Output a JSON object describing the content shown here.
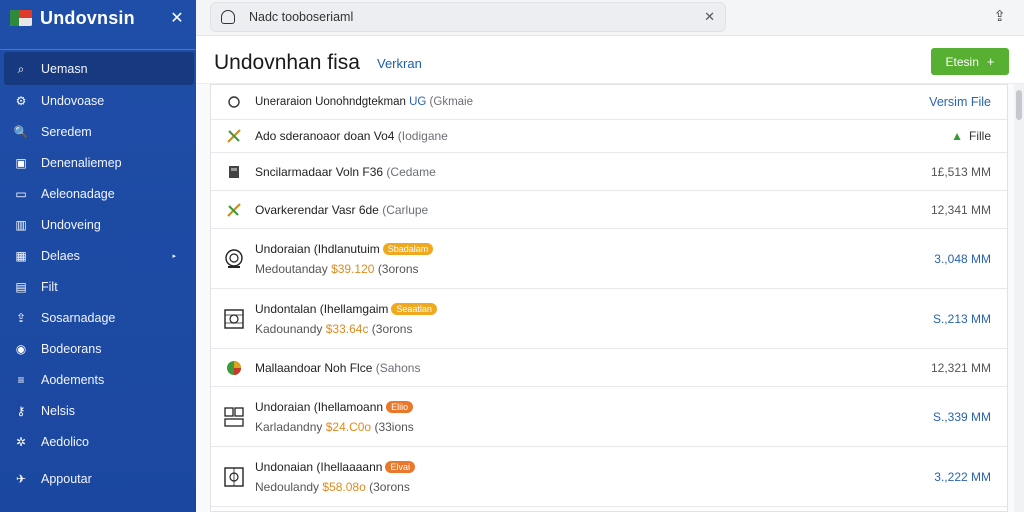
{
  "sidebar": {
    "title": "Undovnsin",
    "close": "✕",
    "items": [
      {
        "label": "Uemasn",
        "icon": "search-icon",
        "glyph": "⌕"
      },
      {
        "label": "Undovoase",
        "icon": "settings-icon",
        "glyph": "⚙"
      },
      {
        "label": "Seredem",
        "icon": "search-icon",
        "glyph": "🔍"
      },
      {
        "label": "Denenaliemep",
        "icon": "briefcase-icon",
        "glyph": "▣"
      },
      {
        "label": "Aeleonadage",
        "icon": "car-icon",
        "glyph": "▭"
      },
      {
        "label": "Undoveing",
        "icon": "chart-icon",
        "glyph": "▥"
      },
      {
        "label": "Delaes",
        "icon": "grid-icon",
        "glyph": "▦",
        "arrow": "▸"
      },
      {
        "label": "Filt",
        "icon": "file-icon",
        "glyph": "▤"
      },
      {
        "label": "Sosarnadage",
        "icon": "share-icon",
        "glyph": "⇪"
      },
      {
        "label": "Bodeorans",
        "icon": "chat-icon",
        "glyph": "◉"
      },
      {
        "label": "Aodements",
        "icon": "list-icon",
        "glyph": "≡"
      },
      {
        "label": "Nelsis",
        "icon": "key-icon",
        "glyph": "⚷"
      },
      {
        "label": "Aedolico",
        "icon": "gear-icon",
        "glyph": "✲"
      },
      {
        "label": "Appoutar",
        "icon": "plane-icon",
        "glyph": "✈"
      }
    ]
  },
  "tab": {
    "label": "Nadc tooboseriaml",
    "close": "✕"
  },
  "top_action_glyph": "⇪",
  "page": {
    "title": "Undovnhan fisa",
    "subtitle": "Verkran",
    "button_label": "Etesin",
    "button_plus": "+"
  },
  "rows": [
    {
      "kind": "head",
      "main": "Uneraraion Uonohndgtekman",
      "tag": "UG",
      "muted": "Gkmaie",
      "right": "Versim File"
    },
    {
      "kind": "thin",
      "main": "Ado sderanoaor doan Vo4",
      "muted": "Iodigane",
      "right": "Fille"
    },
    {
      "kind": "mid",
      "main": "Sncilarmadaar Voln F36",
      "muted": "Cedame",
      "right": "1£,513 MM"
    },
    {
      "kind": "mid",
      "main": "Ovarkerendar Vasr 6de",
      "muted": "Carlupe",
      "right": "12,341 MM"
    },
    {
      "kind": "tall",
      "line1": "Undoraian (Ihdlanutuim",
      "badge": "Sbadalam",
      "badge_color": "amber",
      "line2_a": "Medoutanday",
      "price": "$39.120",
      "line2_b": "(3orons",
      "right": "3.,048 MM"
    },
    {
      "kind": "tall",
      "line1": "Undontalan (Ihellamgaim",
      "badge": "Seaatlan",
      "badge_color": "amber",
      "line2_a": "Kadounandy",
      "price": "$33.64c",
      "line2_b": "(3orons",
      "right": "S.,213 MM"
    },
    {
      "kind": "mid",
      "main": "Mallaandoar Noh Flce",
      "muted": "Sahons",
      "right": "12,321 MM"
    },
    {
      "kind": "tall",
      "line1": "Undoraian (Ihellamoann",
      "badge": "Eliio",
      "badge_color": "orange",
      "line2_a": "Karladandny",
      "price": "$24.C0o",
      "line2_b": "(33ions",
      "right": "S.,339 MM"
    },
    {
      "kind": "tall",
      "line1": "Undonaian (Ihellaaaann",
      "badge": "Elvai",
      "badge_color": "orange",
      "line2_a": "Nedoulandy",
      "price": "$58.08o",
      "line2_b": "(3orons",
      "right": "3.,222 MM"
    }
  ],
  "colors": {
    "sidebar": "#1e4ea8",
    "accent_green": "#58b032",
    "link_blue": "#2a63ad",
    "amber": "#f0a81f"
  }
}
